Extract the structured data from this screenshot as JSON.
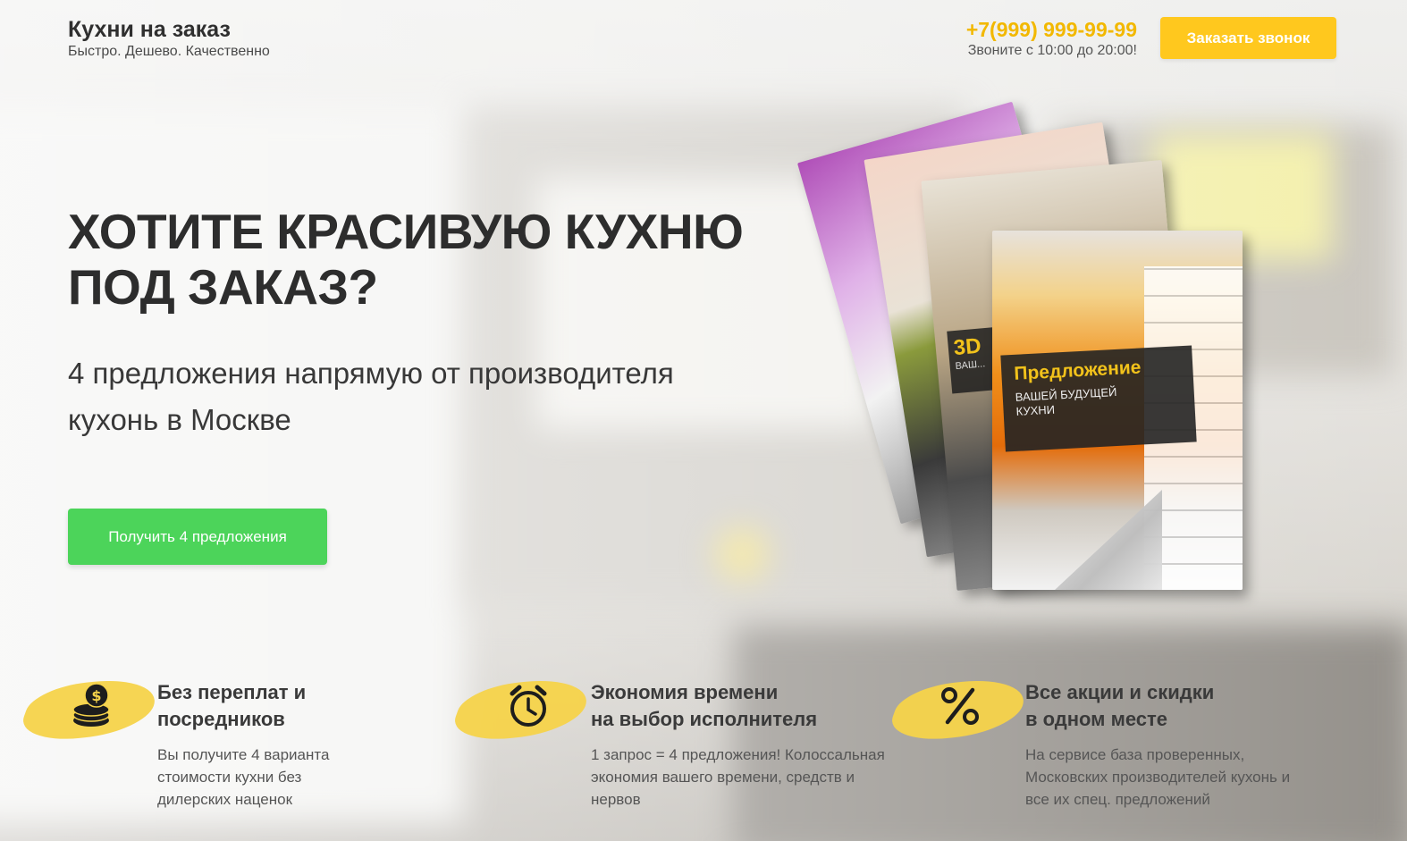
{
  "header": {
    "logo_title": "Кухни на заказ",
    "logo_subtitle": "Быстро. Дешево. Качественно",
    "phone": "+7(999) 999-99-99",
    "hours": "Звоните с 10:00 до 20:00!",
    "call_button": "Заказать звонок"
  },
  "hero": {
    "title_line1": "ХОТИТЕ КРАСИВУЮ КУХНЮ",
    "title_line2": "ПОД ЗАКАЗ?",
    "subtitle_line1": "4 предложения напрямую от производителя",
    "subtitle_line2": "кухонь в Москве",
    "cta_button": "Получить 4 предложения"
  },
  "catalog": {
    "badge_3d": "3D",
    "badge_3d_text": "ВАШ...",
    "cover_title": "Предложение",
    "cover_subtitle": "ВАШЕЙ БУДУЩЕЙ КУХНИ"
  },
  "features": [
    {
      "icon": "coins-icon",
      "title_line1": "Без переплат и",
      "title_line2": "посредников",
      "text": "Вы получите 4 варианта стоимости кухни без дилерских наценок"
    },
    {
      "icon": "alarm-clock-icon",
      "title_line1": "Экономия времени",
      "title_line2": "на выбор исполнителя",
      "text": "1 запрос = 4 предложения! Колоссальная экономия вашего времени, средств и нервов"
    },
    {
      "icon": "percent-icon",
      "title_line1": "Все акции и скидки",
      "title_line2": "в одном месте",
      "text": "На сервисе база проверенных, Московских производителей кухонь и все их спец. предложений"
    }
  ],
  "colors": {
    "accent_yellow": "#ffc81e",
    "phone_yellow": "#f2b800",
    "cta_green": "#4cd45a",
    "brush_yellow": "#f6d34a"
  }
}
